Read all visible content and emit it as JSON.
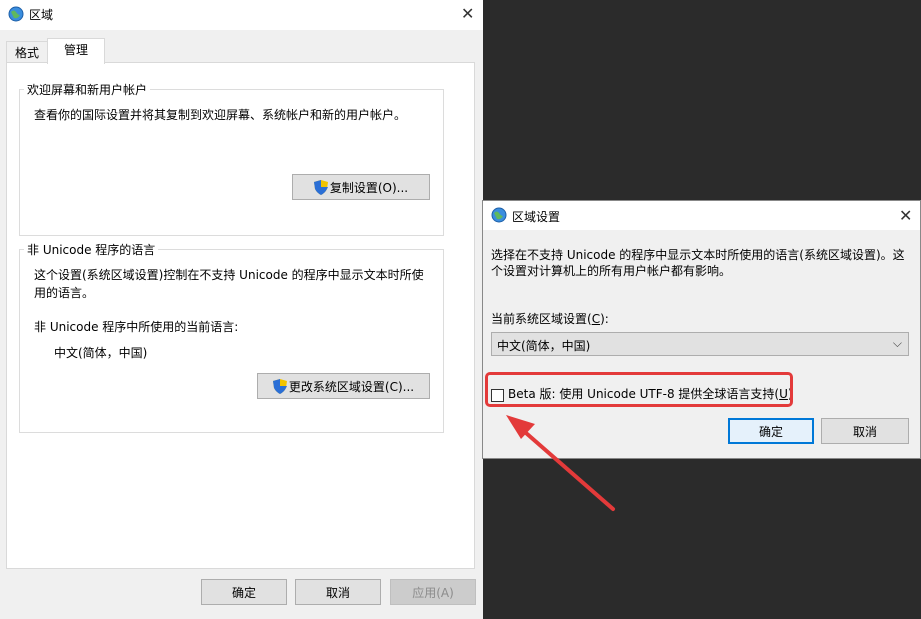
{
  "main_window": {
    "title": "区域",
    "tabs": [
      "格式",
      "管理"
    ],
    "welcome_group": {
      "label": "欢迎屏幕和新用户帐户",
      "description": "查看你的国际设置并将其复制到欢迎屏幕、系统帐户和新的用户帐户。",
      "copy_button": "复制设置(O)..."
    },
    "unicode_group": {
      "label": "非 Unicode 程序的语言",
      "description_line1": "这个设置(系统区域设置)控制在不支持 Unicode 的程序中显示文本时所使",
      "description_line2": "用的语言。",
      "current_label": "非 Unicode 程序中所使用的当前语言:",
      "current_value": "中文(简体，中国)",
      "change_button": "更改系统区域设置(C)..."
    },
    "buttons": {
      "ok": "确定",
      "cancel": "取消",
      "apply": "应用(A)"
    }
  },
  "dialog": {
    "title": "区域设置",
    "description_line1": "选择在不支持 Unicode 的程序中显示文本时所使用的语言(系统区域设置)。这",
    "description_line2": "个设置对计算机上的所有用户帐户都有影响。",
    "locale_label_prefix": "当前系统区域设置(",
    "locale_label_key": "C",
    "locale_label_suffix": "):",
    "locale_value": "中文(简体，中国)",
    "beta_prefix": "Beta 版: 使用 Unicode UTF-8 提供全球语言支持(",
    "beta_key": "U",
    "beta_suffix": ")",
    "beta_checked": false,
    "ok": "确定",
    "cancel": "取消"
  },
  "annotation": {
    "color": "#e33a3a"
  }
}
